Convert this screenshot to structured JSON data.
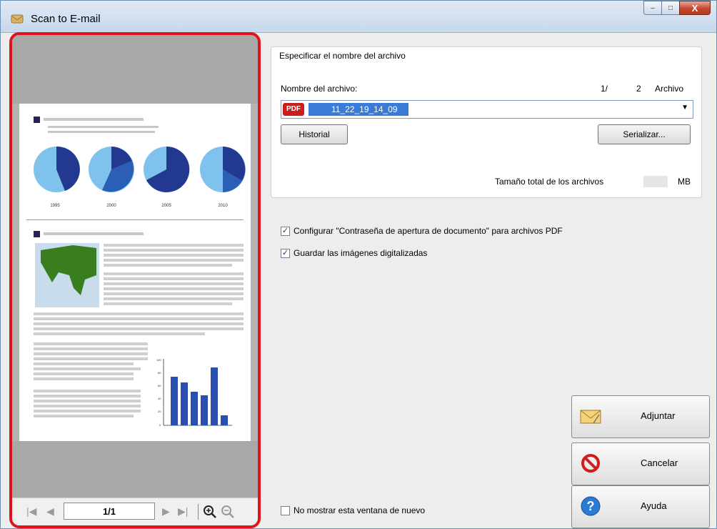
{
  "window": {
    "title": "Scan to E-mail",
    "min_symbol": "–",
    "max_symbol": "□",
    "close_symbol": "X"
  },
  "preview": {
    "page_indicator": "1/1",
    "chart_years": [
      "1995",
      "2000",
      "2005",
      "2010"
    ],
    "bar_axis_ticks": [
      "100",
      "80",
      "60",
      "40",
      "20",
      "0"
    ]
  },
  "file_group": {
    "label": "Especificar el nombre del archivo",
    "name_label": "Nombre del archivo:",
    "counter_current": "1/",
    "counter_total": "2",
    "counter_unit": "Archivo",
    "pdf_badge": "PDF",
    "file_name": "11_22_19_14_09",
    "history_button": "Historial",
    "serialize_button": "Serializar...",
    "total_size_label": "Tamaño total de los archivos",
    "size_unit": "MB"
  },
  "options": {
    "password_label": "Configurar \"Contraseña de apertura de documento\" para archivos PDF",
    "save_images_label": "Guardar las imágenes digitalizadas",
    "dont_show_label": "No mostrar esta ventana de nuevo"
  },
  "actions": {
    "attach": "Adjuntar",
    "cancel": "Cancelar",
    "help": "Ayuda"
  }
}
